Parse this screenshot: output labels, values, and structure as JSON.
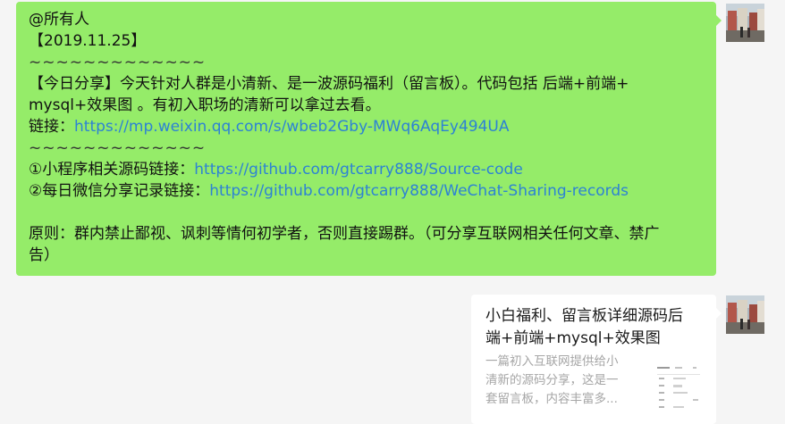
{
  "message": {
    "mention": "@所有人",
    "date": "【2019.11.25】",
    "separator_1": "~~~~~~~~~~~~~",
    "share_line_1": "【今日分享】今天针对人群是小清新、是一波源码福利（留言板）。代码包括 后端+前端+",
    "share_line_2": "mysql+效果图 。有初入职场的清新可以拿过去看。",
    "link_label": "链接：",
    "link_url": "https://mp.weixin.qq.com/s/wbeb2Gby-MWq6AqEy494UA",
    "separator_2": "~~~~~~~~~~~~~",
    "item_1_label": "①小程序相关源码链接：",
    "item_1_url": "https://github.com/gtcarry888/Source-code",
    "item_2_label": "②每日微信分享记录链接：",
    "item_2_url": "https://github.com/gtcarry888/WeChat-Sharing-records",
    "rule_line_1": "原则：群内禁止鄙视、讽刺等情何初学者，否则直接踢群。（可分享互联网相关任何文章、禁广",
    "rule_line_2": "告）"
  },
  "link_card": {
    "title_line_1": "小白福利、留言板详细源码后",
    "title_line_2": "端+前端+mysql+效果图",
    "desc_line_1": "一篇初入互联网提供给小",
    "desc_line_2": "清新的源码分享，这是一",
    "desc_line_3": "套留言板，内容丰富多..."
  },
  "colors": {
    "bubble_green": "#95ec69",
    "link_blue": "#2d82d4",
    "card_bg": "#ffffff",
    "page_bg": "#f5f5f5"
  }
}
